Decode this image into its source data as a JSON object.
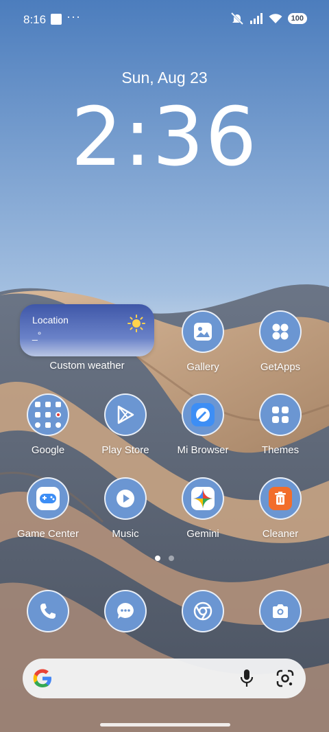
{
  "status_bar": {
    "time": "8:16",
    "dots": "···",
    "battery": "100"
  },
  "lockscreen": {
    "date": "Sun, Aug 23",
    "time": "2:36"
  },
  "weather_widget": {
    "location": "Location",
    "temperature": "_°",
    "label": "Custom weather",
    "icon": "sun-icon"
  },
  "apps": [
    {
      "label": "Gallery",
      "icon": "gallery-icon"
    },
    {
      "label": "GetApps",
      "icon": "getapps-icon"
    },
    {
      "label": "Google",
      "icon": "google-folder-icon"
    },
    {
      "label": "Play Store",
      "icon": "play-store-icon"
    },
    {
      "label": "Mi Browser",
      "icon": "mi-browser-icon"
    },
    {
      "label": "Themes",
      "icon": "themes-icon"
    },
    {
      "label": "Game Center",
      "icon": "game-center-icon"
    },
    {
      "label": "Music",
      "icon": "music-icon"
    },
    {
      "label": "Gemini",
      "icon": "gemini-icon"
    },
    {
      "label": "Cleaner",
      "icon": "cleaner-icon"
    }
  ],
  "pager": {
    "pages": 2,
    "active": 1
  },
  "dock": [
    {
      "icon": "phone-icon"
    },
    {
      "icon": "messages-icon"
    },
    {
      "icon": "chrome-icon"
    },
    {
      "icon": "camera-icon"
    }
  ],
  "search_bar": {
    "logo": "google-g-icon",
    "mic": "microphone-icon",
    "lens": "google-lens-icon"
  },
  "colors": {
    "icon_bg": "#6b96d2",
    "widget_top": "#3f57a8",
    "sky": "#6f9ad0",
    "sand": "#c9a78a"
  }
}
